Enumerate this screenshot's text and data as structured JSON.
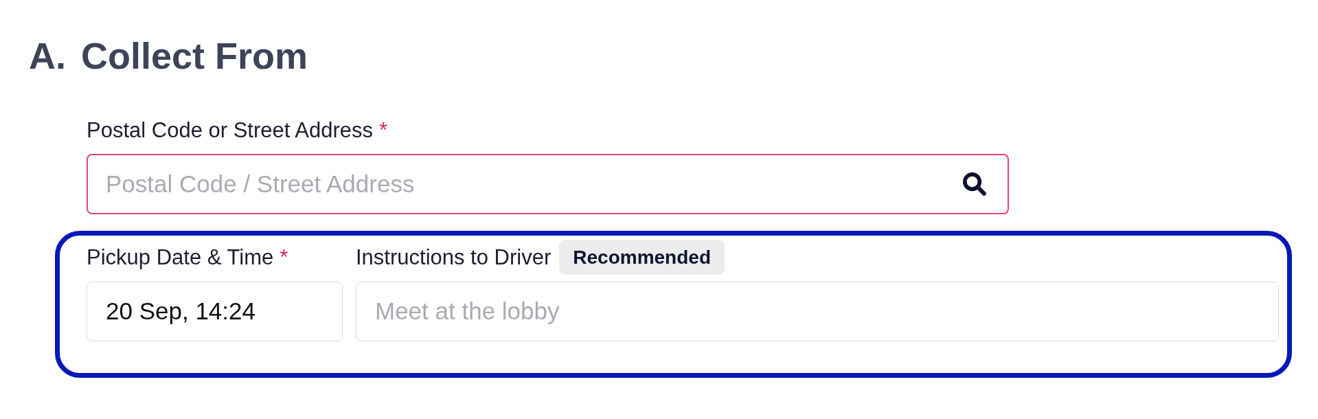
{
  "section": {
    "number": "A.",
    "title": "Collect From"
  },
  "address": {
    "label": "Postal Code or Street Address",
    "required_mark": "*",
    "placeholder": "Postal Code / Street Address",
    "invalid": true
  },
  "pickup_details": {
    "highlighted": true,
    "fields": [
      {
        "label": "Pickup Date & Time",
        "required_mark": "*",
        "value": "20 Sep, 14:24",
        "invalid": false
      },
      {
        "label": "Instructions to Driver",
        "badge": "Recommended",
        "placeholder": "Meet at the lobby",
        "invalid": false
      }
    ]
  }
}
